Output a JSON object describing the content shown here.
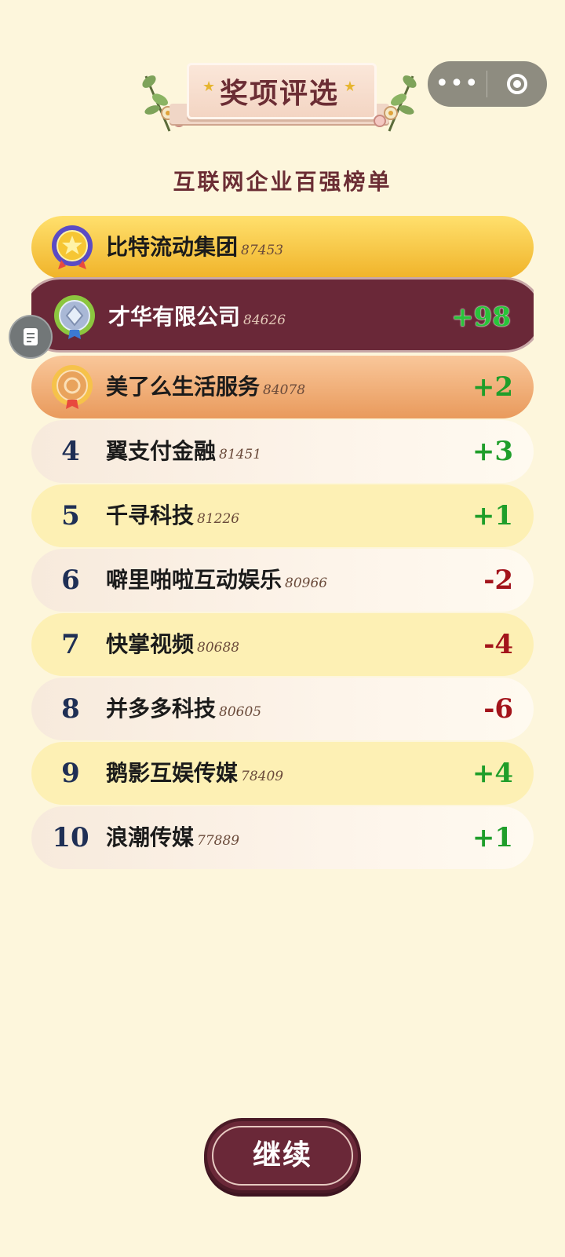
{
  "header": {
    "title": "奖项评选"
  },
  "capsule": {
    "more_icon": "more-dots-icon",
    "close_icon": "target-circle-icon"
  },
  "subtitle": "互联网企业百强榜单",
  "side_button": {
    "icon": "document-icon"
  },
  "rankings": [
    {
      "rank": "1",
      "name": "比特流动集团",
      "score": "87453",
      "delta": "",
      "medal": "gold"
    },
    {
      "rank": "2",
      "name": "才华有限公司",
      "score": "84626",
      "delta": "+98",
      "medal": "silver"
    },
    {
      "rank": "3",
      "name": "美了么生活服务",
      "score": "84078",
      "delta": "+2",
      "medal": "bronze"
    },
    {
      "rank": "4",
      "name": "翼支付金融",
      "score": "81451",
      "delta": "+3"
    },
    {
      "rank": "5",
      "name": "千寻科技",
      "score": "81226",
      "delta": "+1"
    },
    {
      "rank": "6",
      "name": "噼里啪啦互动娱乐",
      "score": "80966",
      "delta": "-2"
    },
    {
      "rank": "7",
      "name": "快掌视频",
      "score": "80688",
      "delta": "-4"
    },
    {
      "rank": "8",
      "name": "并多多科技",
      "score": "80605",
      "delta": "-6"
    },
    {
      "rank": "9",
      "name": "鹅影互娱传媒",
      "score": "78409",
      "delta": "+4"
    },
    {
      "rank": "10",
      "name": "浪潮传媒",
      "score": "77889",
      "delta": "+1"
    }
  ],
  "continue_button": {
    "label": "继续"
  },
  "colors": {
    "background": "#fdf6dc",
    "maroon": "#6a2838",
    "gain": "#1f9e2a",
    "loss": "#a3141b"
  }
}
